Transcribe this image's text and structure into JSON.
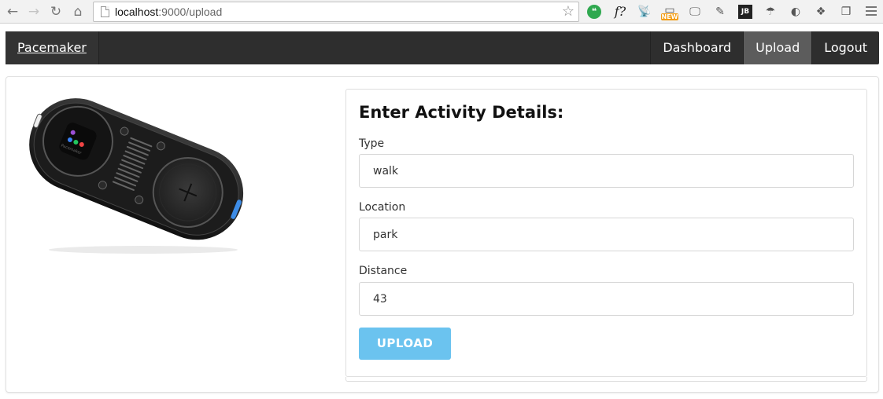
{
  "browser": {
    "url_host": "localhost",
    "url_path": ":9000/upload",
    "back_icon": "arrow-left-icon",
    "forward_icon": "arrow-right-icon",
    "reload_icon": "reload-icon",
    "home_icon": "home-icon",
    "bookmark_icon": "star-icon",
    "extensions": {
      "f_label": "f?",
      "new_badge": "NEW",
      "jb_label": "JB"
    }
  },
  "navbar": {
    "brand": "Pacemaker",
    "items": [
      {
        "label": "Dashboard",
        "active": false
      },
      {
        "label": "Upload",
        "active": true
      },
      {
        "label": "Logout",
        "active": false
      }
    ]
  },
  "form": {
    "title": "Enter Activity Details:",
    "type_label": "Type",
    "type_value": "walk",
    "location_label": "Location",
    "location_value": "park",
    "distance_label": "Distance",
    "distance_value": "43",
    "submit_label": "UPLOAD"
  },
  "device": {
    "screen_label": "Pacemaker"
  },
  "colors": {
    "navbar_bg": "#2e2e2e",
    "navbar_active": "#5c5c5c",
    "button_bg": "#6bc3ef"
  }
}
